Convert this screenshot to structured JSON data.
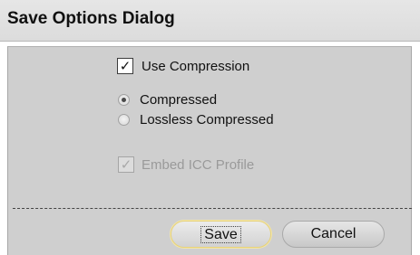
{
  "window": {
    "title": "Save Options Dialog"
  },
  "options": {
    "use_compression": {
      "label": "Use Compression",
      "checked": true,
      "mark": "✓"
    },
    "compression_mode": {
      "items": [
        {
          "label": "Compressed",
          "selected": true
        },
        {
          "label": "Lossless Compressed",
          "selected": false
        }
      ]
    },
    "embed_icc": {
      "label": "Embed ICC Profile",
      "checked": true,
      "enabled": false,
      "mark": "✓"
    }
  },
  "buttons": {
    "save_label": "Save",
    "cancel_label": "Cancel"
  }
}
